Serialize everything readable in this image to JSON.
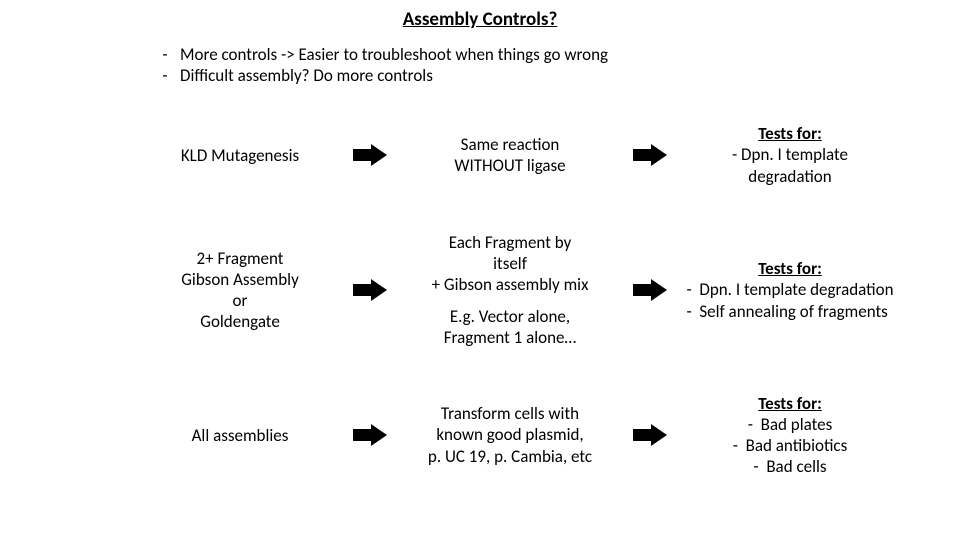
{
  "title": "Assembly Controls?",
  "bullets": {
    "b1": "More controls -> Easier to troubleshoot when things go wrong",
    "b2": "Difficult assembly? Do more controls"
  },
  "rows": {
    "r1": {
      "left": "KLD Mutagenesis",
      "mid_l1": "Same reaction",
      "mid_l2": "WITHOUT ligase",
      "tests_heading": "Tests for:",
      "tests_l1": "- Dpn. I template",
      "tests_l2": "degradation"
    },
    "r2": {
      "left_l1": "2+ Fragment",
      "left_l2": "Gibson Assembly",
      "left_l3": "or",
      "left_l4": "Goldengate",
      "mid_l1": "Each Fragment by",
      "mid_l2": "itself",
      "mid_l3": "+ Gibson assembly mix",
      "mid_l4": "E.g. Vector alone,",
      "mid_l5": "Fragment 1 alone…",
      "tests_heading": "Tests for:",
      "tests_i1": "Dpn. I template degradation",
      "tests_i2": "Self annealing of fragments"
    },
    "r3": {
      "left": "All assemblies",
      "mid_l1": "Transform cells with",
      "mid_l2": "known good plasmid,",
      "mid_l3": "p. UC 19, p. Cambia, etc",
      "tests_heading": "Tests for:",
      "tests_i1": "Bad plates",
      "tests_i2": "Bad antibiotics",
      "tests_i3": "Bad cells"
    }
  }
}
